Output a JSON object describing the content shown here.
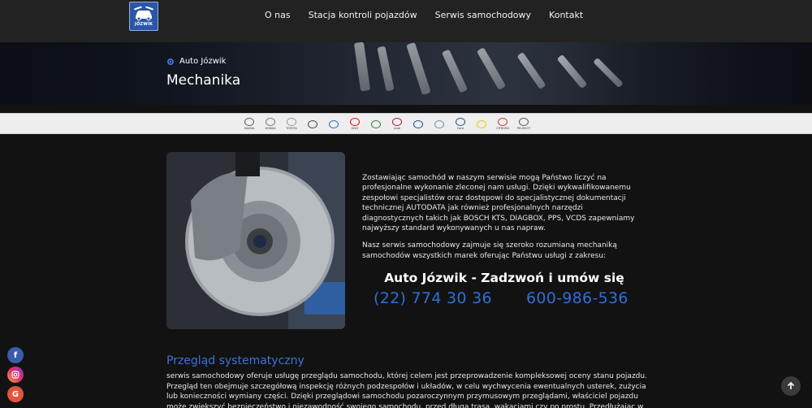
{
  "header": {
    "logo_text": "JÓZWIK",
    "nav": [
      "O nas",
      "Stacja kontroli pojazdów",
      "Serwis samochodowy",
      "Kontakt"
    ]
  },
  "hero": {
    "breadcrumb": "Auto Józwik",
    "title": "Mechanika"
  },
  "brands": [
    {
      "name": "mazda",
      "label": "MAZDA"
    },
    {
      "name": "honda",
      "label": "HONDA"
    },
    {
      "name": "toyota",
      "label": "TOYOTA"
    },
    {
      "name": "mercedes",
      "label": ""
    },
    {
      "name": "bmw",
      "label": ""
    },
    {
      "name": "seat",
      "label": "SEAT"
    },
    {
      "name": "skoda",
      "label": ""
    },
    {
      "name": "audi",
      "label": "Audi"
    },
    {
      "name": "volkswagen",
      "label": ""
    },
    {
      "name": "volvo",
      "label": ""
    },
    {
      "name": "ford",
      "label": "Ford"
    },
    {
      "name": "renault",
      "label": ""
    },
    {
      "name": "citroen",
      "label": "CITROËN"
    },
    {
      "name": "peugeot",
      "label": "PEUGEOT"
    }
  ],
  "intro": {
    "p1": "Zostawiając samochód w naszym serwisie mogą Państwo liczyć na profesjonalne wykonanie zleconej nam usługi. Dzięki wykwalifikowanemu zespołowi specjalistów oraz dostępowi do specjalistycznej dokumentacji technicznej AUTODATA jak również profesjonalnych narzędzi diagnostycznych takich jak BOSCH KTS, DIAGBOX, PPS, VCDS zapewniamy najwyższy standard wykonywanych u nas napraw.",
    "p2": "Nasz serwis samochodowy zajmuje się szeroko rozumianą mechaniką samochodów wszystkich marek oferując Państwu usługi z zakresu:"
  },
  "cta": {
    "title": "Auto Józwik - Zadzwoń i umów się",
    "phone1": "(22) 774 30 36",
    "phone2": "600-986-536"
  },
  "section": {
    "title": "Przegląd systematyczny",
    "text": "serwis samochodowy oferuje usługę przeglądu samochodu, której celem jest przeprowadzenie kompleksowej oceny stanu pojazdu. Przegląd ten obejmuje szczegółową inspekcję różnych podzespołów i układów, w celu wychwycenia ewentualnych usterek, zużycia lub konieczności wymiany części. Dzięki przeglądowi samochodu pozaroczynnym przymusowym przeglądami, właściciel pojazdu może zwiększyć bezpieczeństwo i niezawodność swojego samochodu, przed długą trasą, wakacjami czy po prostu. Przedłużając w"
  },
  "colors": {
    "accent": "#2f6fd6",
    "section_title": "#3a74d8",
    "background": "#121212",
    "header": "#222222"
  }
}
